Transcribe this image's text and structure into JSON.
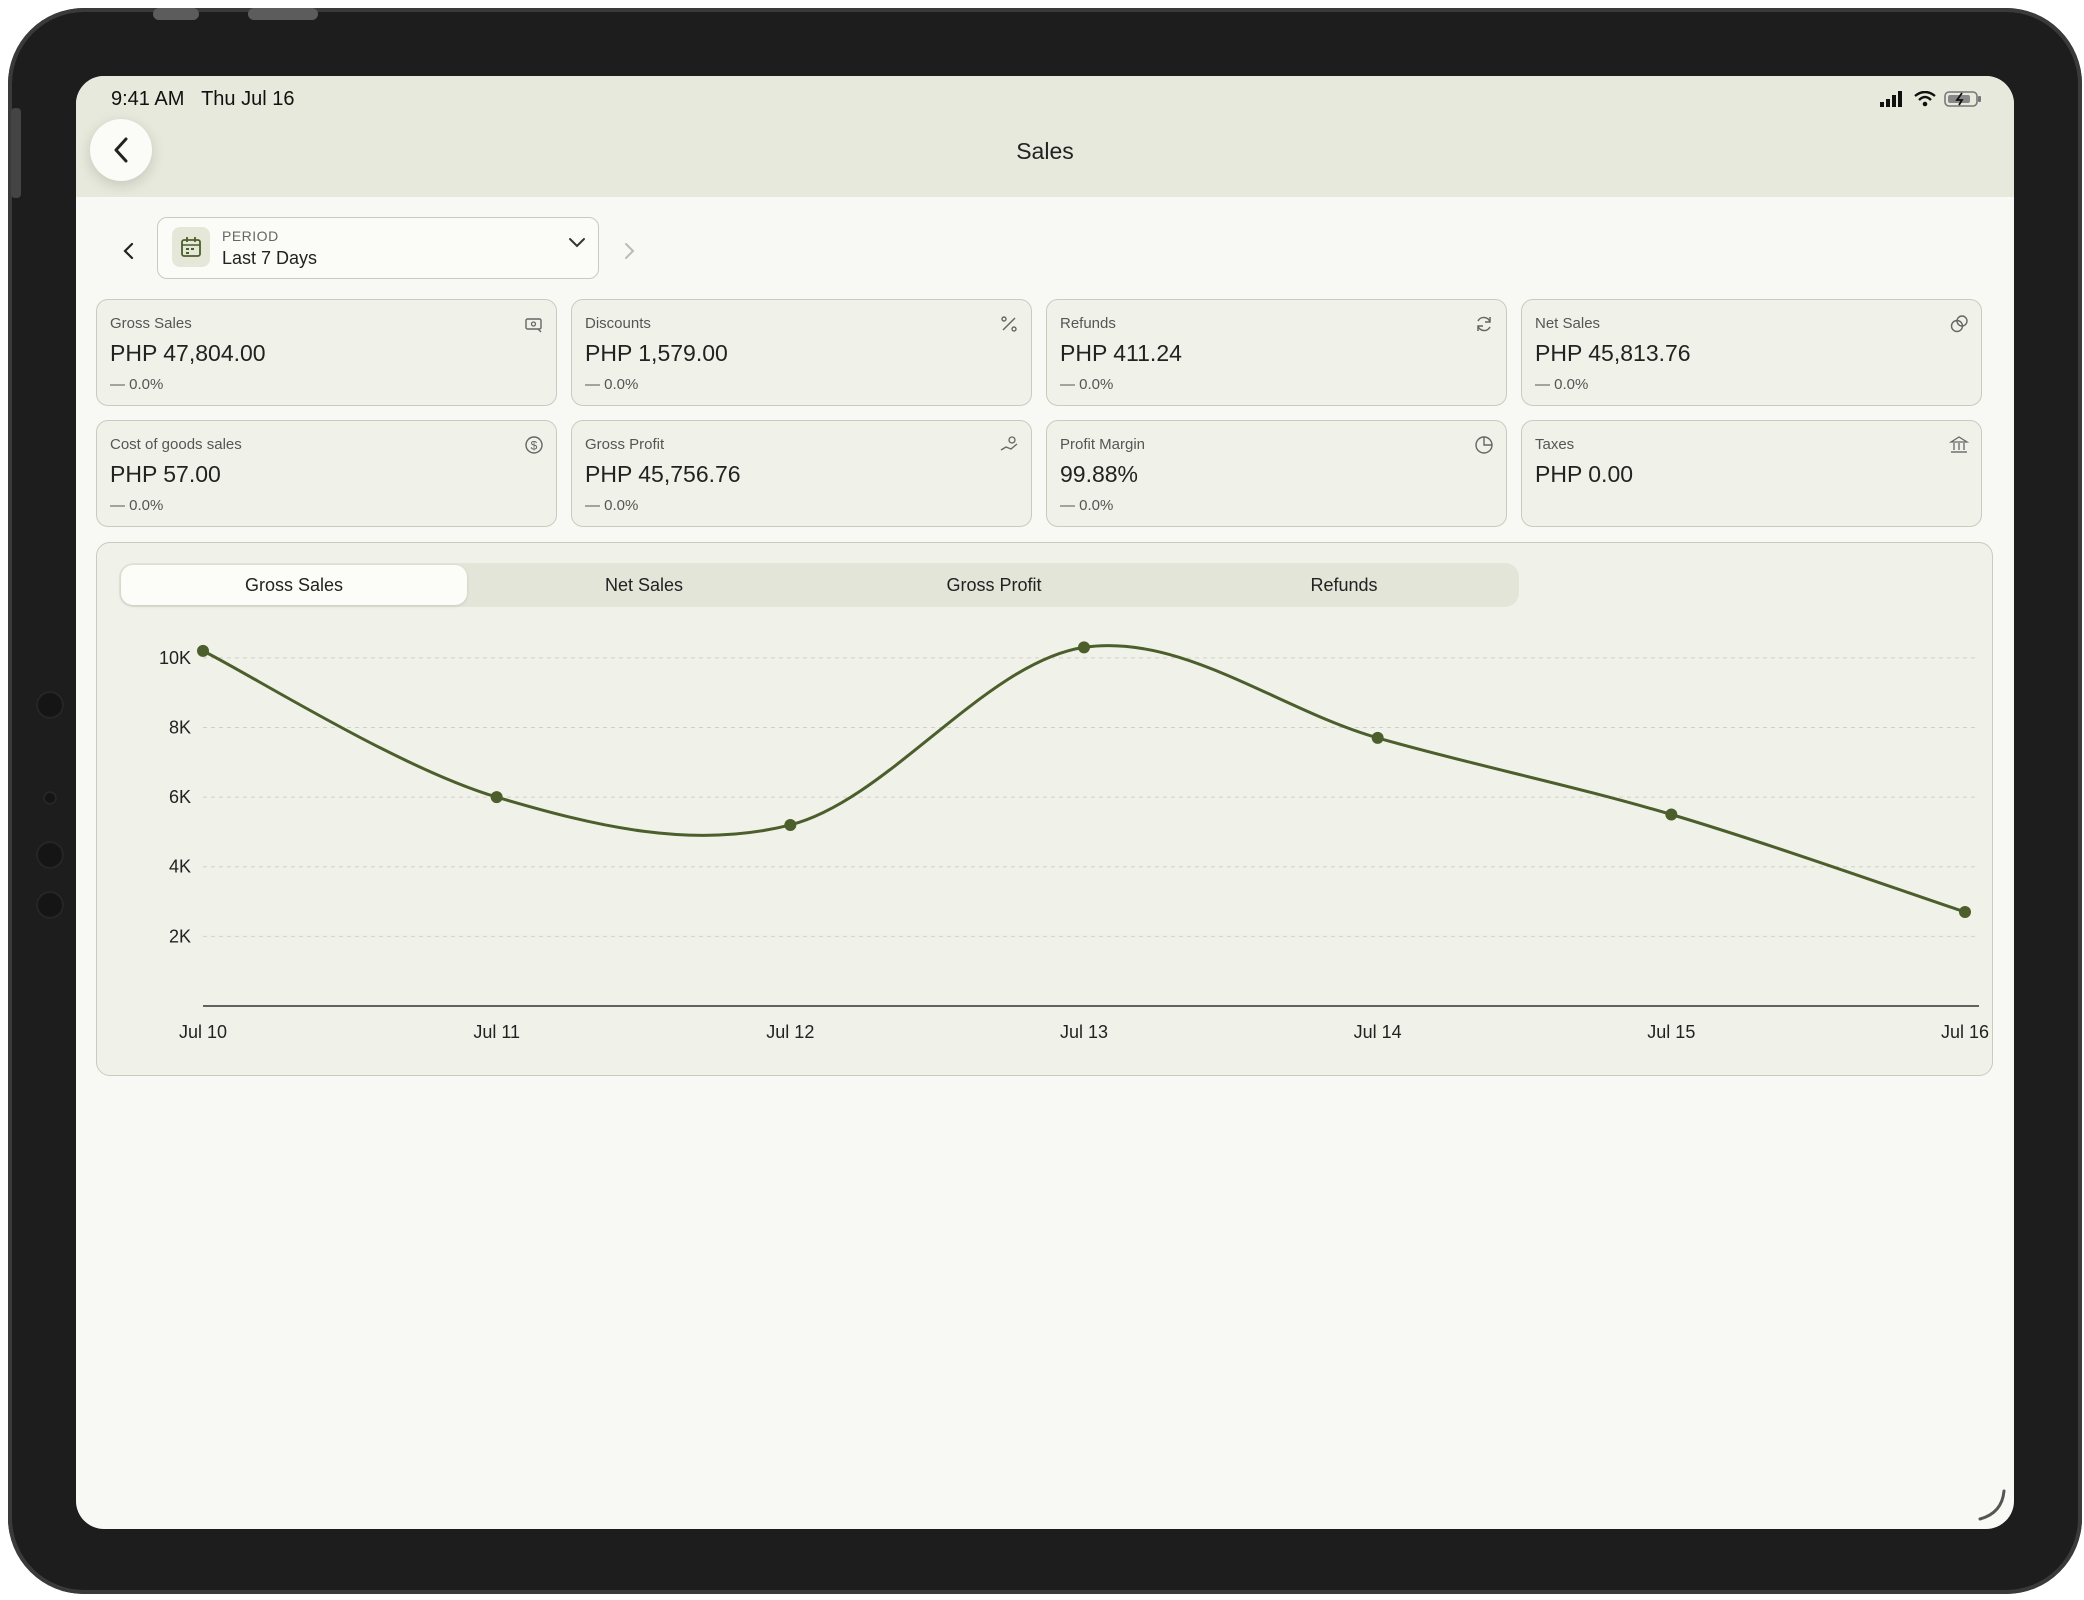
{
  "status_bar": {
    "time": "9:41 AM",
    "date": "Thu Jul 16"
  },
  "header": {
    "title": "Sales",
    "back_icon": "chevron-left-icon"
  },
  "period": {
    "label": "PERIOD",
    "value": "Last 7 Days"
  },
  "cards": [
    {
      "label": "Gross Sales",
      "value": "PHP 47,804.00",
      "change": "— 0.0%",
      "icon": "cash-register-icon"
    },
    {
      "label": "Discounts",
      "value": "PHP 1,579.00",
      "change": "— 0.0%",
      "icon": "percent-icon"
    },
    {
      "label": "Refunds",
      "value": "PHP 411.24",
      "change": "— 0.0%",
      "icon": "refresh-icon"
    },
    {
      "label": "Net Sales",
      "value": "PHP 45,813.76",
      "change": "— 0.0%",
      "icon": "coins-icon"
    },
    {
      "label": "Cost of goods sales",
      "value": "PHP 57.00",
      "change": "— 0.0%",
      "icon": "dollar-circle-icon"
    },
    {
      "label": "Gross Profit",
      "value": "PHP 45,756.76",
      "change": "— 0.0%",
      "icon": "money-hand-icon"
    },
    {
      "label": "Profit Margin",
      "value": "99.88%",
      "change": "— 0.0%",
      "icon": "pie-chart-icon"
    },
    {
      "label": "Taxes",
      "value": "PHP 0.00",
      "change": "",
      "icon": "bank-icon"
    }
  ],
  "tabs": [
    {
      "label": "Gross Sales",
      "active": true
    },
    {
      "label": "Net Sales",
      "active": false
    },
    {
      "label": "Gross Profit",
      "active": false
    },
    {
      "label": "Refunds",
      "active": false
    }
  ],
  "colors": {
    "line": "#4b5e2b",
    "accent_bg": "#e7e9dc"
  },
  "chart_data": {
    "type": "line",
    "categories": [
      "Jul 10",
      "Jul 11",
      "Jul 12",
      "Jul 13",
      "Jul 14",
      "Jul 15",
      "Jul 16"
    ],
    "series": [
      {
        "values": [
          10200,
          6000,
          5200,
          10300,
          7700,
          5500,
          2700
        ]
      }
    ],
    "yticks": [
      {
        "v": 2000,
        "label": "2K"
      },
      {
        "v": 4000,
        "label": "4K"
      },
      {
        "v": 6000,
        "label": "6K"
      },
      {
        "v": 8000,
        "label": "8K"
      },
      {
        "v": 10000,
        "label": "10K"
      }
    ],
    "ylim": [
      0,
      11000
    ],
    "grid": true,
    "smooth": true
  }
}
